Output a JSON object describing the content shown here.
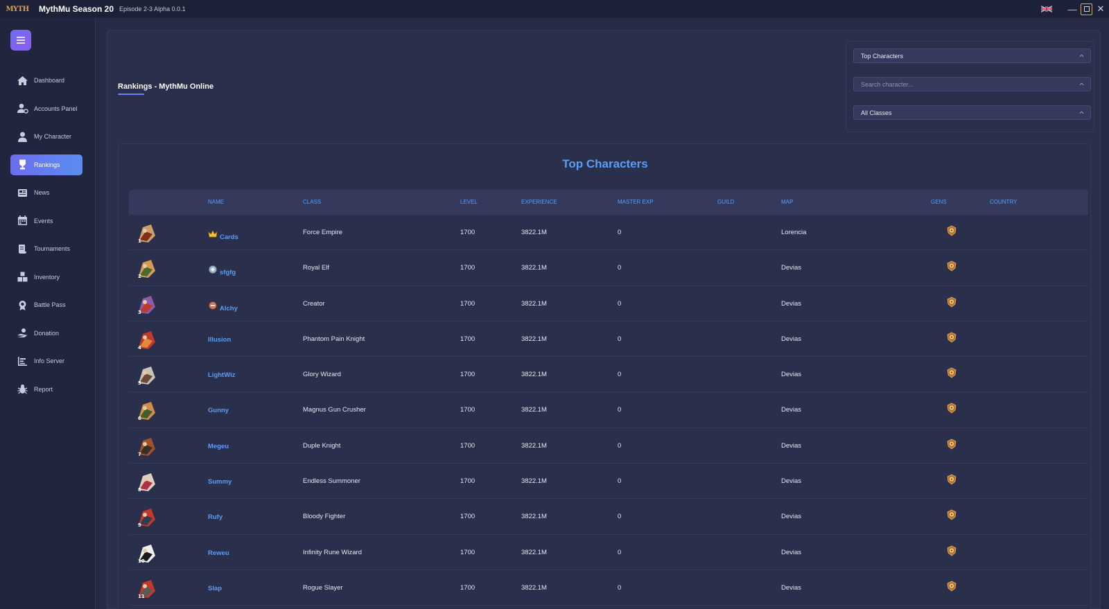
{
  "titlebar": {
    "logo_text": "MYTH",
    "app_title": "MythMu Season 20",
    "app_subtitle": "Episode 2-3 Alpha 0.0.1",
    "flag_icon": "uk-flag-icon",
    "minimize_label": "—",
    "close_label": "✕"
  },
  "sidebar": {
    "items": [
      {
        "label": "Dashboard",
        "icon": "home-icon",
        "active": false
      },
      {
        "label": "Accounts Panel",
        "icon": "user-cog-icon",
        "active": false
      },
      {
        "label": "My Character",
        "icon": "user-icon",
        "active": false
      },
      {
        "label": "Rankings",
        "icon": "trophy-icon",
        "active": true
      },
      {
        "label": "News",
        "icon": "newspaper-icon",
        "active": false
      },
      {
        "label": "Events",
        "icon": "calendar-icon",
        "active": false
      },
      {
        "label": "Tournaments",
        "icon": "scroll-icon",
        "active": false
      },
      {
        "label": "Inventory",
        "icon": "boxes-icon",
        "active": false
      },
      {
        "label": "Battle Pass",
        "icon": "medal-icon",
        "active": false
      },
      {
        "label": "Donation",
        "icon": "donate-icon",
        "active": false
      },
      {
        "label": "Info Server",
        "icon": "chart-icon",
        "active": false
      },
      {
        "label": "Report",
        "icon": "bug-icon",
        "active": false
      }
    ]
  },
  "main": {
    "page_title": "Rankings - MythMu Online",
    "filters": {
      "ranking_type": "Top Characters",
      "search_placeholder": "Search character...",
      "class_filter": "All Classes"
    },
    "table": {
      "title": "Top Characters",
      "columns": [
        "NAME",
        "CLASS",
        "LEVEL",
        "EXPERIENCE",
        "MASTER EXP",
        "GUILD",
        "MAP",
        "GENS",
        "COUNTRY"
      ],
      "rows": [
        {
          "rank": "1",
          "badge": "gold-crown",
          "name": "Cards",
          "class": "Force Empire",
          "level": "1700",
          "experience": "3822.1M",
          "master_exp": "0",
          "guild": "",
          "map": "Lorencia",
          "country": ""
        },
        {
          "rank": "2",
          "badge": "silver-crown",
          "name": "sfgfg",
          "class": "Royal Elf",
          "level": "1700",
          "experience": "3822.1M",
          "master_exp": "0",
          "guild": "",
          "map": "Devias",
          "country": ""
        },
        {
          "rank": "3",
          "badge": "bronze-crown",
          "name": "Alchy",
          "class": "Creator",
          "level": "1700",
          "experience": "3822.1M",
          "master_exp": "0",
          "guild": "",
          "map": "Devias",
          "country": ""
        },
        {
          "rank": "4",
          "badge": "",
          "name": "Illusion",
          "class": "Phantom Pain Knight",
          "level": "1700",
          "experience": "3822.1M",
          "master_exp": "0",
          "guild": "",
          "map": "Devias",
          "country": ""
        },
        {
          "rank": "5",
          "badge": "",
          "name": "LightWiz",
          "class": "Glory Wizard",
          "level": "1700",
          "experience": "3822.1M",
          "master_exp": "0",
          "guild": "",
          "map": "Devias",
          "country": ""
        },
        {
          "rank": "6",
          "badge": "",
          "name": "Gunny",
          "class": "Magnus Gun Crusher",
          "level": "1700",
          "experience": "3822.1M",
          "master_exp": "0",
          "guild": "",
          "map": "Devias",
          "country": ""
        },
        {
          "rank": "7",
          "badge": "",
          "name": "Megeu",
          "class": "Duple Knight",
          "level": "1700",
          "experience": "3822.1M",
          "master_exp": "0",
          "guild": "",
          "map": "Devias",
          "country": ""
        },
        {
          "rank": "8",
          "badge": "",
          "name": "Summy",
          "class": "Endless Summoner",
          "level": "1700",
          "experience": "3822.1M",
          "master_exp": "0",
          "guild": "",
          "map": "Devias",
          "country": ""
        },
        {
          "rank": "9",
          "badge": "",
          "name": "Rufy",
          "class": "Bloody Fighter",
          "level": "1700",
          "experience": "3822.1M",
          "master_exp": "0",
          "guild": "",
          "map": "Devias",
          "country": ""
        },
        {
          "rank": "10",
          "badge": "",
          "name": "Reweu",
          "class": "Infinity Rune Wizard",
          "level": "1700",
          "experience": "3822.1M",
          "master_exp": "0",
          "guild": "",
          "map": "Devias",
          "country": ""
        },
        {
          "rank": "11",
          "badge": "",
          "name": "Slap",
          "class": "Rogue Slayer",
          "level": "1700",
          "experience": "3822.1M",
          "master_exp": "0",
          "guild": "",
          "map": "Devias",
          "country": ""
        }
      ]
    }
  },
  "colors": {
    "accent": "#5b9ef6",
    "active_nav_start": "#6c6df0",
    "active_nav_end": "#5b8df0",
    "background": "#262b45",
    "panel": "#2a2f4c",
    "sidebar": "#21253d",
    "gold": "#e8b21d"
  }
}
